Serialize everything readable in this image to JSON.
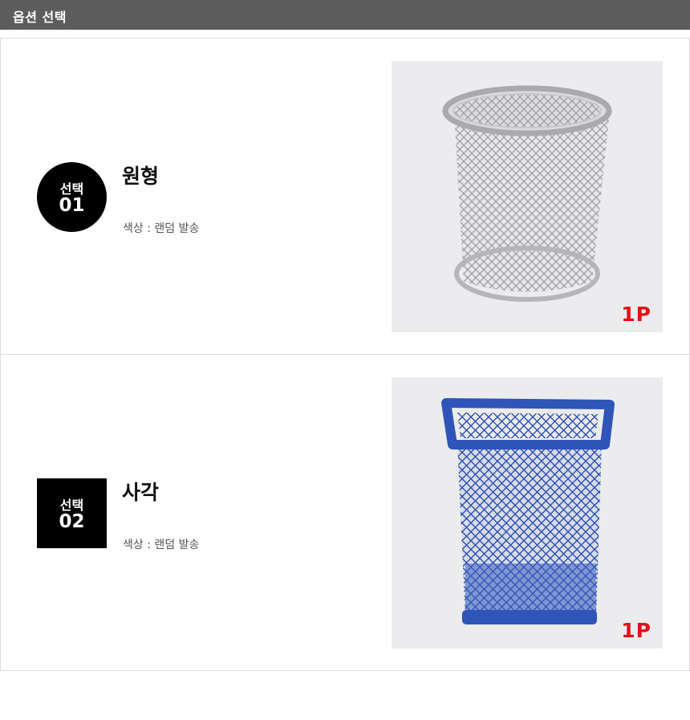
{
  "header": {
    "title": "옵션 선택"
  },
  "options": [
    {
      "badge_label": "선택",
      "badge_number": "01",
      "name": "원형",
      "description": "색상 : 랜덤 발송",
      "quantity": "1P",
      "product_color": "#c8c8cc",
      "badge_shape": "circle"
    },
    {
      "badge_label": "선택",
      "badge_number": "02",
      "name": "사각",
      "description": "색상 : 랜덤 발송",
      "quantity": "1P",
      "product_color": "#2f55b8",
      "badge_shape": "square"
    }
  ],
  "colors": {
    "header_bg": "#5d5d5d",
    "badge_bg": "#000000",
    "quantity_text": "#e0101a"
  }
}
